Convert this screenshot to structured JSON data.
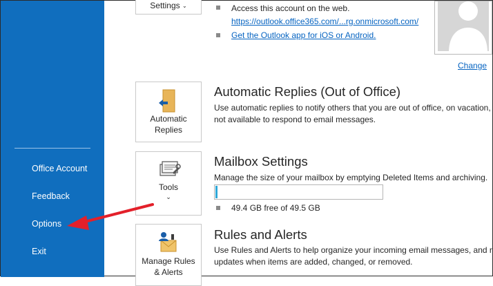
{
  "sidebar": {
    "items": [
      {
        "label": "Office Account"
      },
      {
        "label": "Feedback"
      },
      {
        "label": "Options"
      },
      {
        "label": "Exit"
      }
    ]
  },
  "account": {
    "settings_button": "Settings",
    "bullets": [
      {
        "text": "Access this account on the web."
      },
      {
        "text": "https://outlook.office365.com/...rg.onmicrosoft.com/"
      },
      {
        "text": "Get the Outlook app for iOS or Android."
      }
    ],
    "change_link": "Change"
  },
  "automatic_replies": {
    "tile_line1": "Automatic",
    "tile_line2": "Replies",
    "title": "Automatic Replies (Out of Office)",
    "desc_line1": "Use automatic replies to notify others that you are out of office, on vacation,",
    "desc_line2": "not available to respond to email messages."
  },
  "mailbox": {
    "tile_label": "Tools",
    "title": "Mailbox Settings",
    "desc": "Manage the size of your mailbox by emptying Deleted Items and archiving.",
    "free_text": "49.4 GB free of 49.5 GB",
    "used_fraction": 0.003
  },
  "rules": {
    "tile_line1": "Manage Rules",
    "tile_line2": "& Alerts",
    "title": "Rules and Alerts",
    "desc_line1": "Use Rules and Alerts to help organize your incoming email messages, and rec",
    "desc_line2": "updates when items are added, changed, or removed."
  },
  "colors": {
    "sidebar": "#106ebe",
    "link": "#0563c1",
    "progress": "#2ea8d8",
    "arrow": "#e3202a"
  },
  "icons": [
    "chevron-down-icon",
    "automatic-replies-icon",
    "tools-icon",
    "rules-alerts-icon",
    "profile-placeholder-icon",
    "annotation-arrow"
  ]
}
